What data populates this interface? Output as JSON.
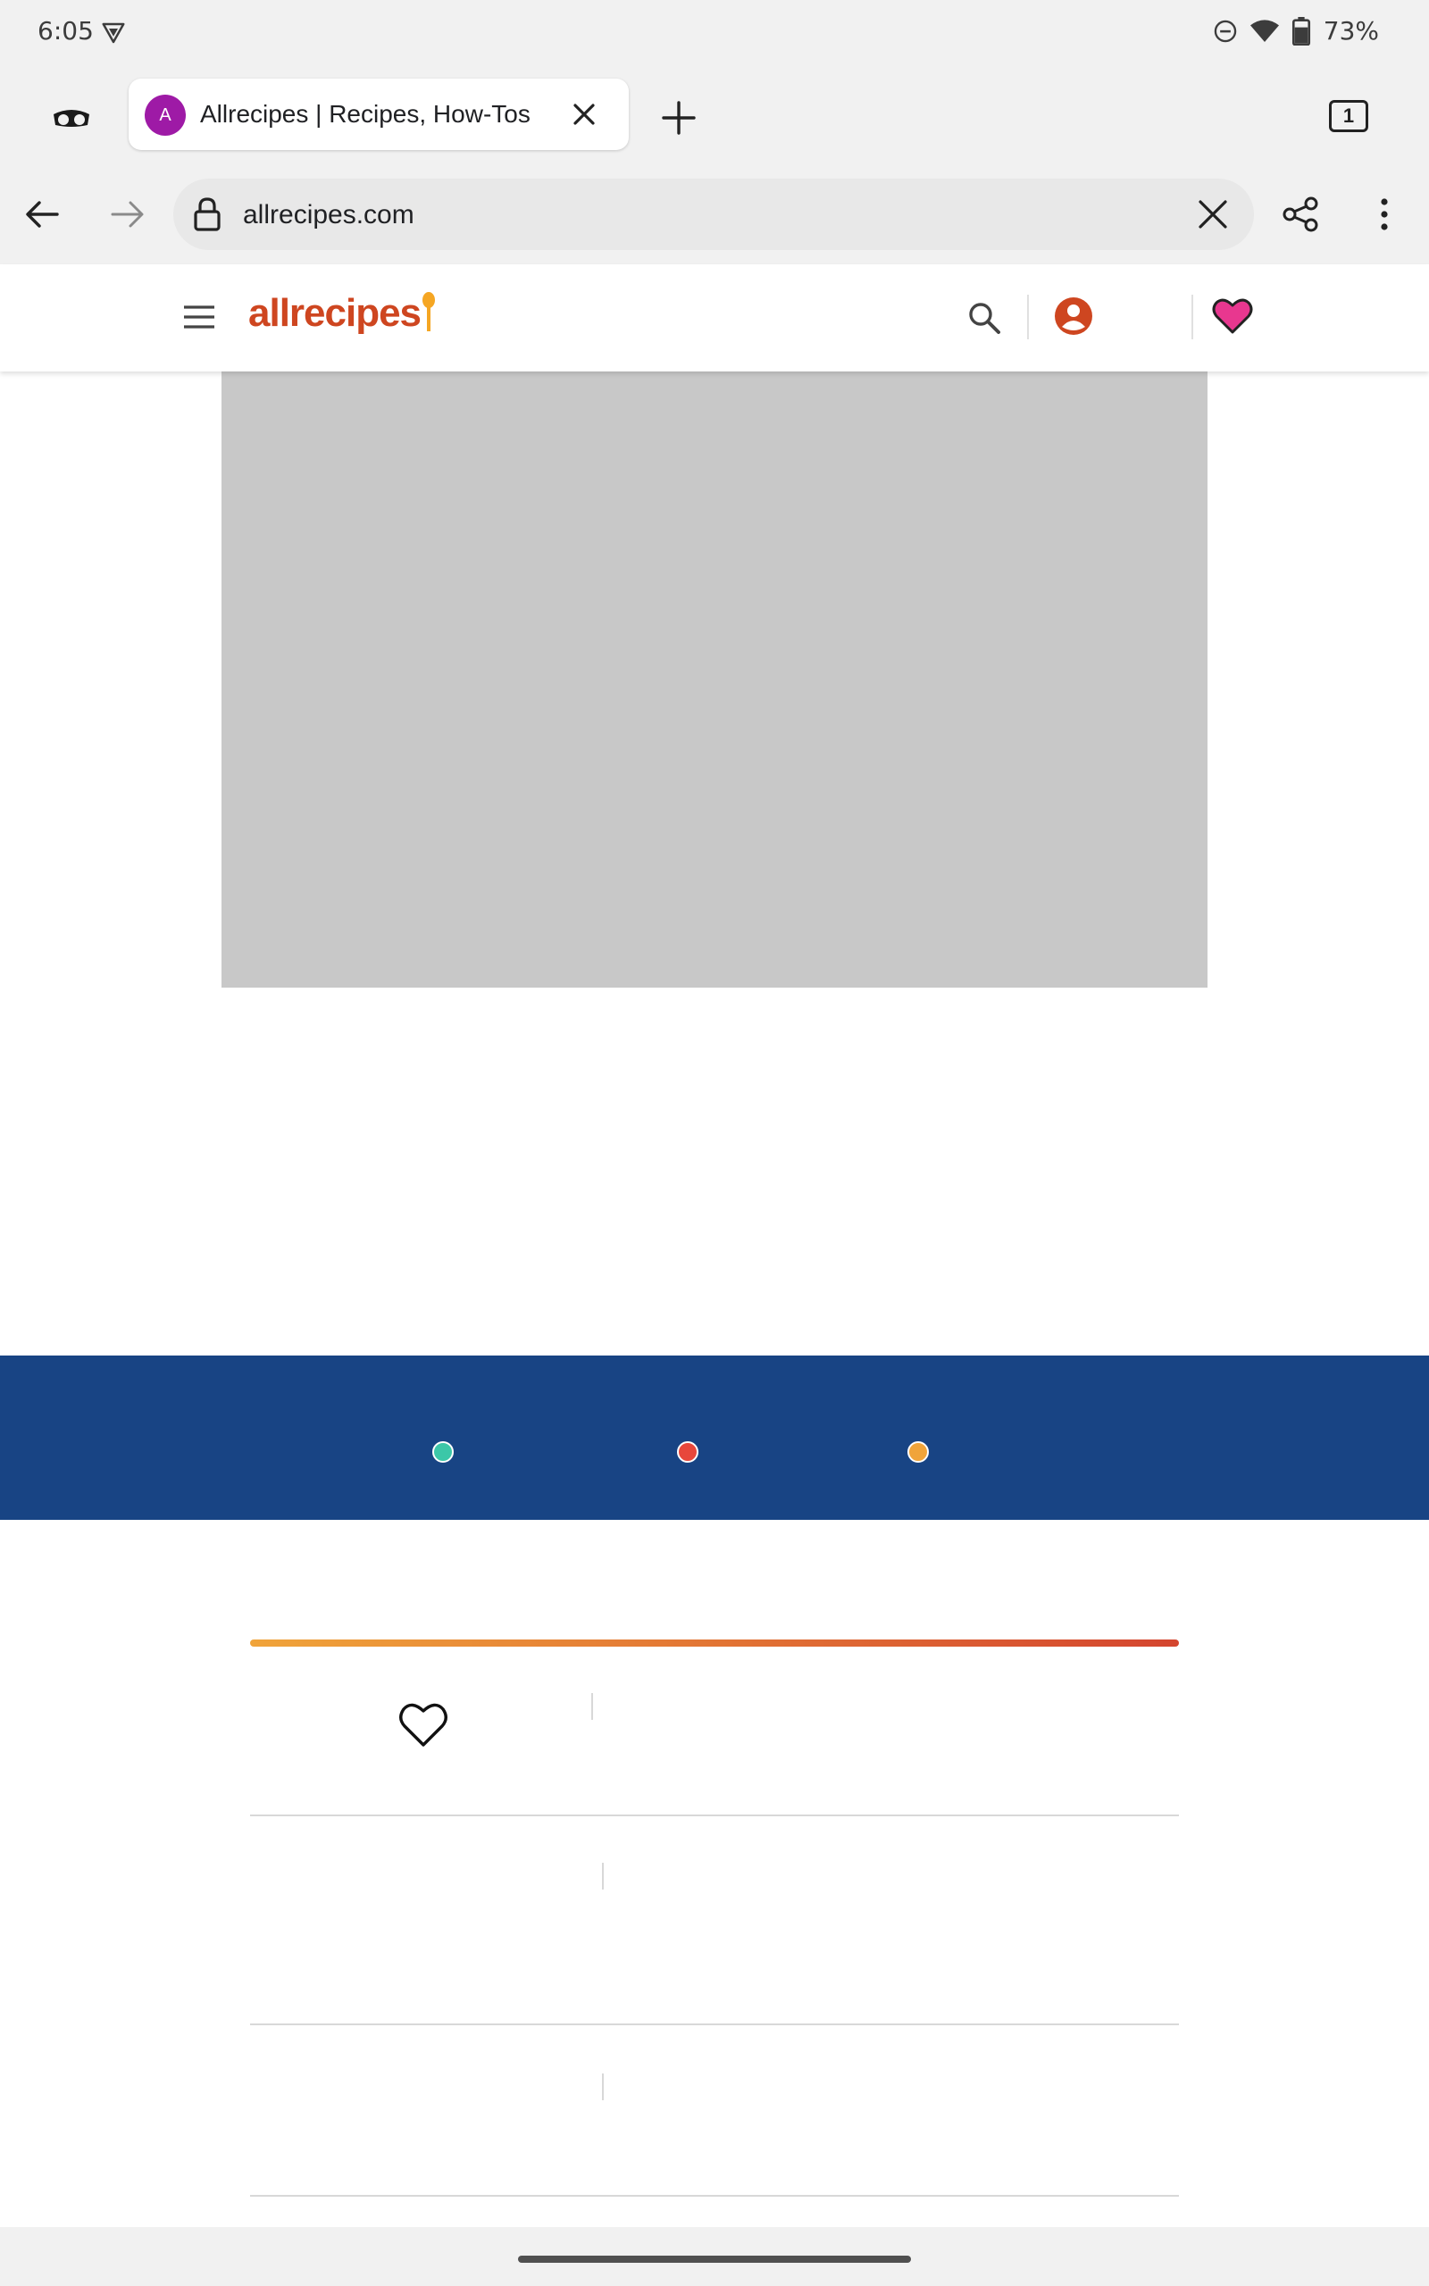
{
  "status_bar": {
    "time": "6:05",
    "battery": "73%"
  },
  "tab": {
    "favicon_letter": "A",
    "title": "Allrecipes | Recipes, How-Tos"
  },
  "tab_switcher": {
    "count": "1"
  },
  "omnibox": {
    "url": "allrecipes.com"
  },
  "site_header": {
    "logo_text": "allrecipes",
    "brand_color": "#ce4620"
  },
  "carousel": {
    "band_color": "#184484",
    "dot_colors": [
      "#3cc7a8",
      "#e8473b",
      "#f0a43a"
    ]
  }
}
